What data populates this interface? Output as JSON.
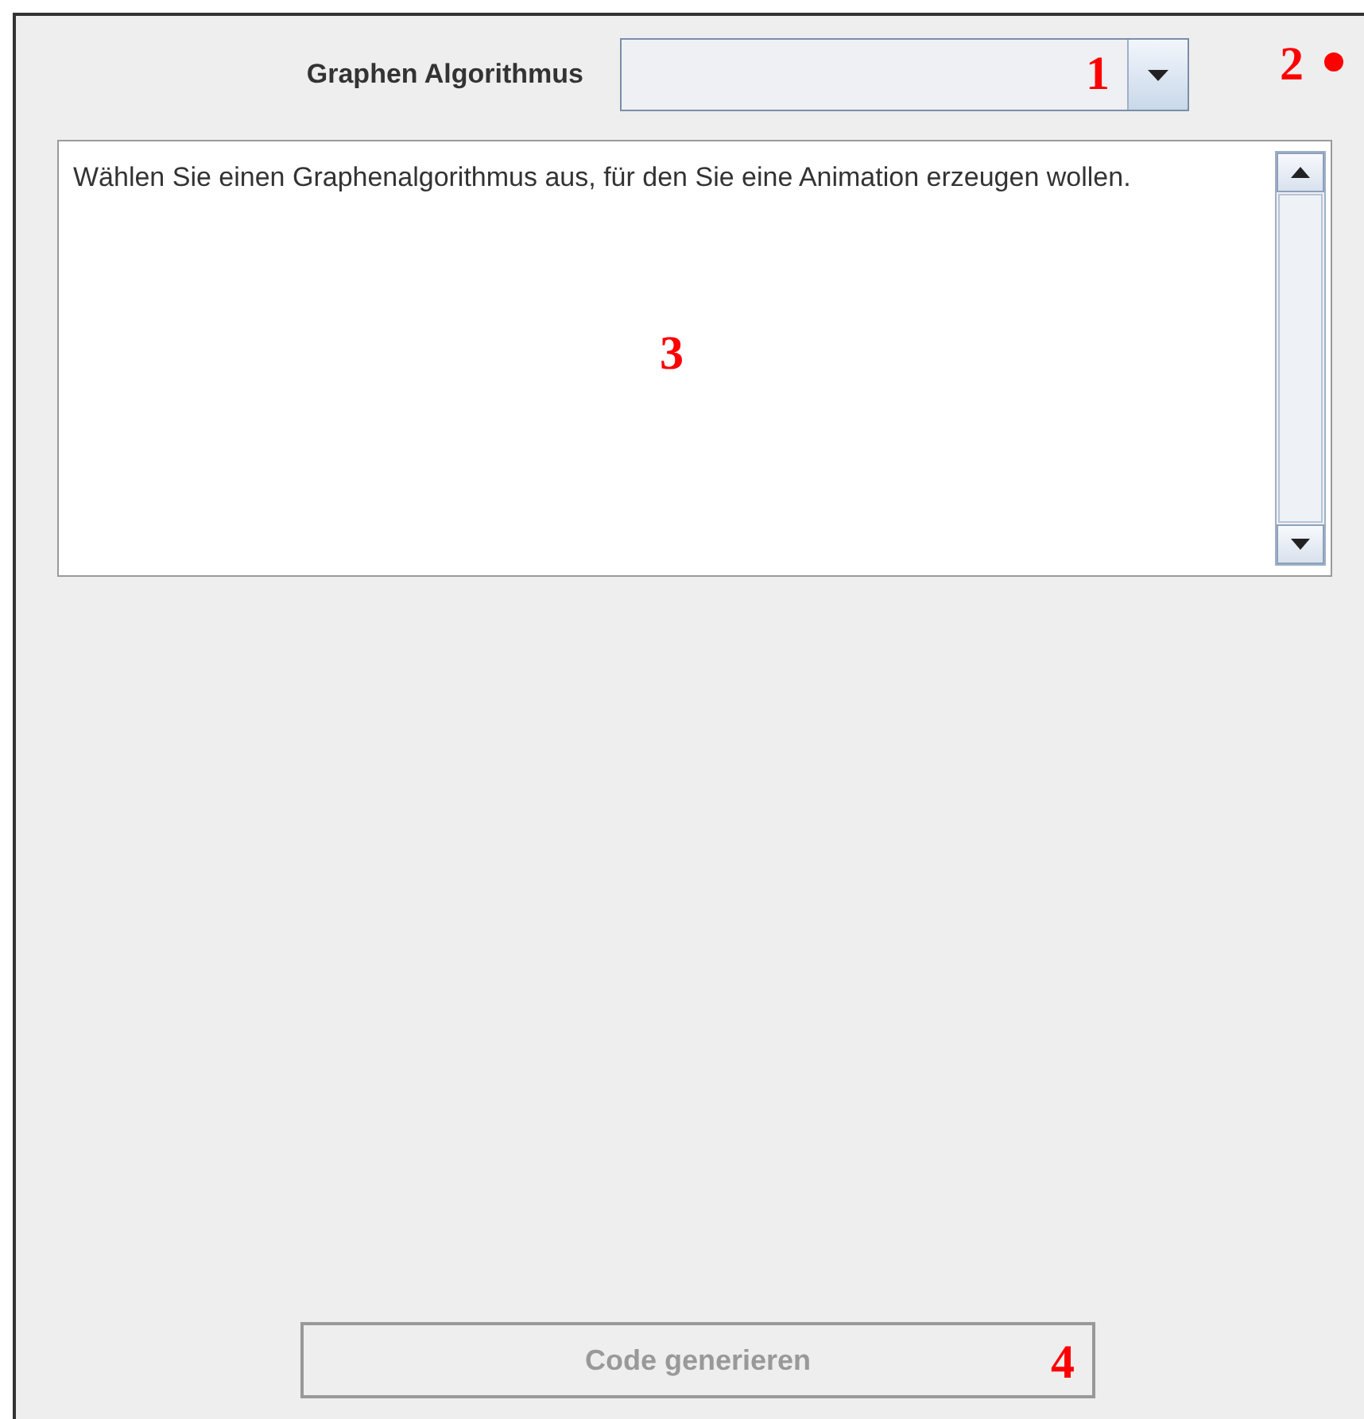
{
  "algorithm_label": "Graphen Algorithmus",
  "description": "Wählen Sie einen Graphenalgorithmus aus, für den Sie eine Animation erzeugen wollen.",
  "generate_button": {
    "label": "Code generieren",
    "disabled": true
  },
  "annotations": [
    {
      "label": "1"
    },
    {
      "label": "2"
    },
    {
      "label": "3"
    },
    {
      "label": "4"
    }
  ]
}
